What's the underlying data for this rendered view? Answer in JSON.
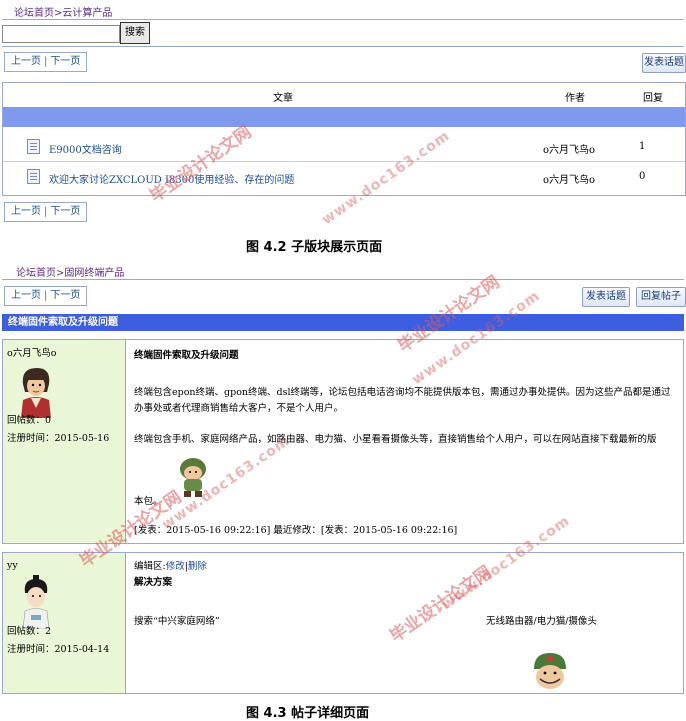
{
  "fig1": {
    "breadcrumb": "论坛首页>云计算产品",
    "search": {
      "value": "",
      "button": "搜索"
    },
    "pager_prev": "上一页",
    "pager_sep": "|",
    "pager_next": "下一页",
    "new_topic": "发表话题",
    "table": {
      "headers": [
        "文章",
        "作者",
        "回复"
      ],
      "rows": [
        {
          "title": "E9000文档咨询",
          "author": "o六月飞鸟o",
          "replies": "1"
        },
        {
          "title": "欢迎大家讨论ZXCLOUD I8300使用经验、存在的问题",
          "author": "o六月飞鸟o",
          "replies": "0"
        }
      ]
    },
    "caption": "图 4.2 子版块展示页面"
  },
  "fig2": {
    "breadcrumb": "论坛首页>固网终端产品",
    "pager_prev": "上一页",
    "pager_sep": "|",
    "pager_next": "下一页",
    "new_topic": "发表话题",
    "reply": "回复帖子",
    "topic_title": "终端固件索取及升级问题",
    "posts": [
      {
        "user": "o六月飞鸟o",
        "post_count": "回帖数：0",
        "reg_time": "注册时间：2015-05-16",
        "title": "终端固件索取及升级问题",
        "para1": "终端包含epon终端、gpon终端、dsl终端等，论坛包括电话咨询均不能提供版本包，需通过办事处提供。因为这些产品都是通过办事处或者代理商销售给大客户，不是个人用户。",
        "para2": "终端包含手机、家庭网络产品，如路由器、电力猫、小星看看摄像头等，直接销售给个人用户，可以在网站直接下载最新的版",
        "para3": "本包。",
        "footer": "[发表：2015-05-16 09:22:16] 最近修改：[发表：2015-05-16 09:22:16]"
      },
      {
        "user": "yy",
        "post_count": "回帖数：2",
        "reg_time": "注册时间：2015-04-14",
        "edit_prefix": "编辑区:",
        "edit_link": "修改",
        "delete_link": "删除",
        "title": "解决方案",
        "search_text": "搜索“中兴家庭网络”",
        "right_text": "无线路由器/电力猫/摄像头"
      }
    ],
    "caption": "图 4.3 帖子详细页面"
  },
  "watermark_cn": "毕业设计论文网",
  "watermark_url": "www.doc163.com"
}
